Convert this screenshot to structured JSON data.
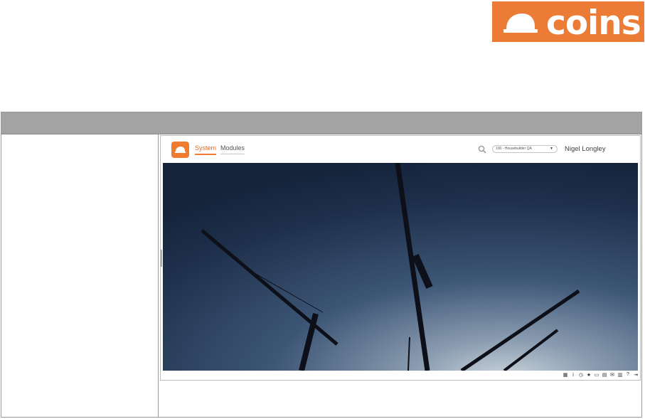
{
  "brand": {
    "name": "coins"
  },
  "app": {
    "nav": {
      "system": "System",
      "modules": "Modules"
    },
    "company_select": {
      "value": "100 - Housebuilder QA"
    },
    "user_name": "Nigel Longley",
    "footer_icons": [
      "grid-icon",
      "info-icon",
      "history-icon",
      "star-icon",
      "bookmark-icon",
      "print-icon",
      "mail-icon",
      "library-icon",
      "help-icon",
      "logout-icon"
    ],
    "accent": "#f07a2e"
  },
  "colors": {
    "brand": "#ec7b36",
    "table_header": "#a3a3a3"
  }
}
